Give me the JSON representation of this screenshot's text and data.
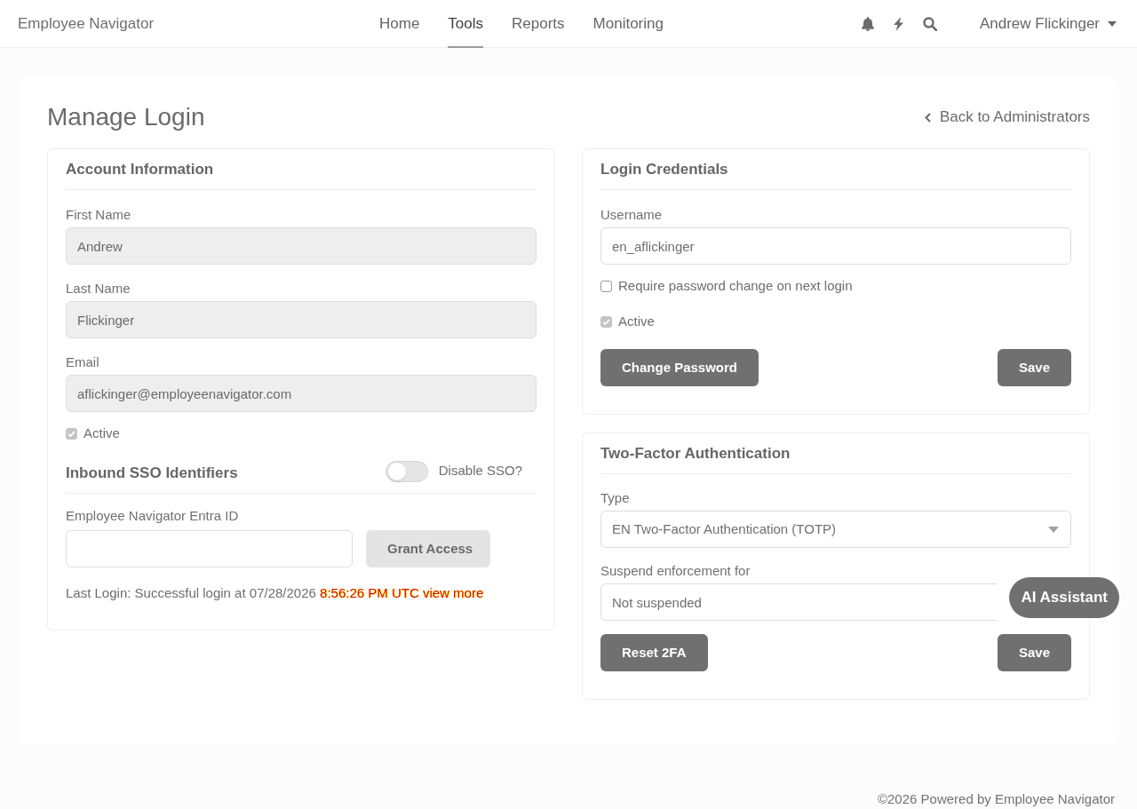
{
  "navbar": {
    "brand": "Employee Navigator",
    "links": [
      {
        "label": "Home",
        "selected": false
      },
      {
        "label": "Tools",
        "selected": true
      },
      {
        "label": "Reports",
        "selected": false
      },
      {
        "label": "Monitoring",
        "selected": false
      }
    ],
    "user_menu": "Andrew Flickinger"
  },
  "page": {
    "title": "Manage Login",
    "back_link": "Back to Administrators"
  },
  "account_information": {
    "heading": "Account Information",
    "fields": [
      {
        "label": "First Name",
        "value": "Andrew",
        "disabled": true
      },
      {
        "label": "Last Name",
        "value": "Flickinger",
        "disabled": true
      },
      {
        "label": "Email",
        "value": "aflickinger@employeenavigator.com",
        "disabled": true
      }
    ],
    "active": {
      "label": "Active",
      "checked": true,
      "disabled": true
    },
    "sso": {
      "heading": "Inbound SSO Identifiers",
      "toggle": {
        "label": "Disable SSO?",
        "on": false
      },
      "field": {
        "label": "Employee Navigator Entra ID",
        "disabled": false
      },
      "button": {
        "label": "Grant Access",
        "disabled": true
      }
    },
    "last_login": {
      "text": "Last Login: Successful login at 07/28/2026",
      "time": "8:56:26 PM UTC",
      "link": "view more"
    }
  },
  "login_credentials": {
    "heading": "Login Credentials",
    "fields": [
      {
        "label": "Username",
        "value": "en_aflickinger",
        "disabled": false
      }
    ],
    "checkboxes": [
      {
        "label": "Require password change on next login",
        "checked": false,
        "disabled": false
      },
      {
        "label": "Active",
        "checked": true,
        "disabled": true
      }
    ],
    "buttons": [
      {
        "label": "Change Password",
        "disabled": false
      },
      {
        "label": "Save",
        "disabled": false
      }
    ]
  },
  "two_factor": {
    "heading": "Two-Factor Authentication",
    "fields": [
      {
        "label": "Type",
        "value": "EN Two-Factor Authentication (TOTP)",
        "kind": "select",
        "disabled": false
      },
      {
        "label": "Suspend enforcement for",
        "value": "Not suspended",
        "kind": "text",
        "disabled": false
      }
    ],
    "buttons": [
      {
        "label": "Reset 2FA",
        "disabled": false
      },
      {
        "label": "Save",
        "disabled": false
      }
    ]
  },
  "assistant_button": "AI Assistant",
  "footer": "©2026 Powered by Employee Navigator"
}
